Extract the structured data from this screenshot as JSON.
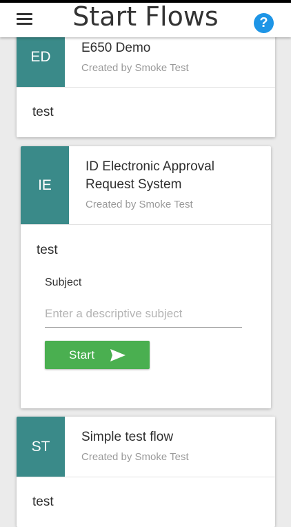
{
  "header": {
    "title": "Start Flows",
    "menu_icon": "hamburger-menu-icon",
    "help_icon": "help-icon",
    "help_glyph": "?",
    "help_color": "#1e95e6"
  },
  "colors": {
    "avatar": "#3a8a89",
    "start_button": "#4aaf50"
  },
  "flows": [
    {
      "initials": "ED",
      "title": "E650 Demo",
      "created_by": "Created by Smoke Test",
      "description": "test"
    },
    {
      "initials": "IE",
      "title": "ID Electronic Approval Request System",
      "created_by": "Created by Smoke Test",
      "description": "test",
      "subject_label": "Subject",
      "subject_value": "",
      "subject_placeholder": "Enter a descriptive subject",
      "start_label": "Start",
      "start_icon": "send-icon"
    },
    {
      "initials": "ST",
      "title": "Simple test flow",
      "created_by": "Created by Smoke Test",
      "description": "test"
    }
  ]
}
